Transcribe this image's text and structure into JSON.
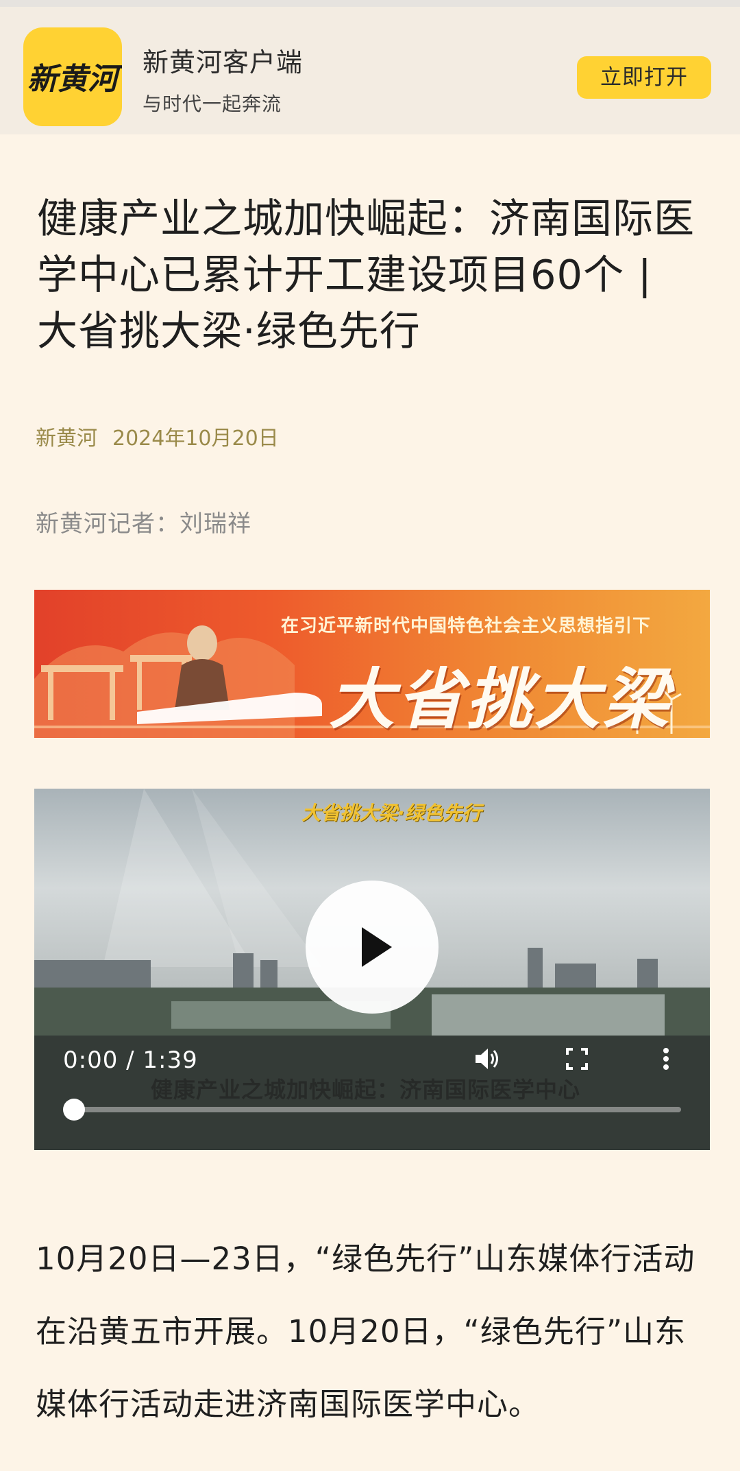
{
  "app": {
    "logo_text": "新黄河",
    "name": "新黄河客户端",
    "slogan": "与时代一起奔流",
    "open_button": "立即打开"
  },
  "article": {
    "title": "健康产业之城加快崛起：济南国际医学中心已累计开工建设项目60个 | 大省挑大梁·绿色先行",
    "source": "新黄河",
    "date": "2024年10月20日",
    "byline": "新黄河记者：刘瑞祥",
    "body": "10月20日—23日，“绿色先行”山东媒体行活动在沿黄五市开展。10月20日，“绿色先行”山东媒体行活动走进济南国际医学中心。"
  },
  "banner": {
    "subtitle": "在习近平新时代中国特色社会主义思想指引下",
    "main": "大省挑大梁"
  },
  "video": {
    "overlay_tag": "大省挑大梁·绿色先行",
    "overlay_caption": "健康产业之城加快崛起：济南国际医学中心",
    "time": "0:00 / 1:39",
    "progress": 0,
    "icons": [
      "play-icon",
      "volume-icon",
      "fullscreen-icon",
      "more-icon"
    ]
  },
  "colors": {
    "page_bg": "#fdf4e7",
    "brand_yellow": "#ffd233",
    "meta_text": "#9a8a4a"
  }
}
